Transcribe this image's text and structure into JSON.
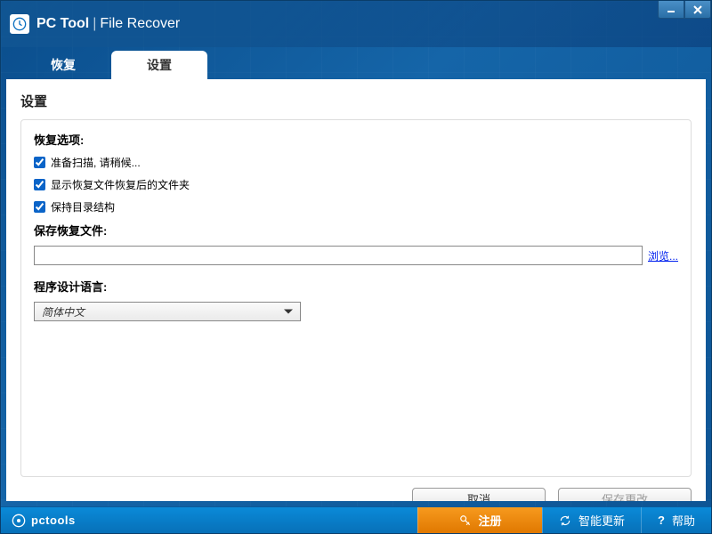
{
  "window": {
    "title_brand": "PC Tool",
    "title_product": "File Recover"
  },
  "tabs": {
    "recover": "恢复",
    "settings": "设置"
  },
  "page": {
    "title": "设置"
  },
  "recover_options": {
    "label": "恢复选项:",
    "prepare_scan": {
      "checked": true,
      "label": "准备扫描, 请稍候..."
    },
    "show_folder": {
      "checked": true,
      "label": "显示恢复文件恢复后的文件夹"
    },
    "keep_structure": {
      "checked": true,
      "label": "保持目录结构"
    }
  },
  "save_path": {
    "label": "保存恢复文件:",
    "value": "",
    "browse": "浏览..."
  },
  "language": {
    "label": "程序设计语言:",
    "selected": "简体中文"
  },
  "buttons": {
    "cancel": "取消",
    "save": "保存更改"
  },
  "footer": {
    "brand": "pctools",
    "register": "注册",
    "update": "智能更新",
    "help": "帮助"
  }
}
